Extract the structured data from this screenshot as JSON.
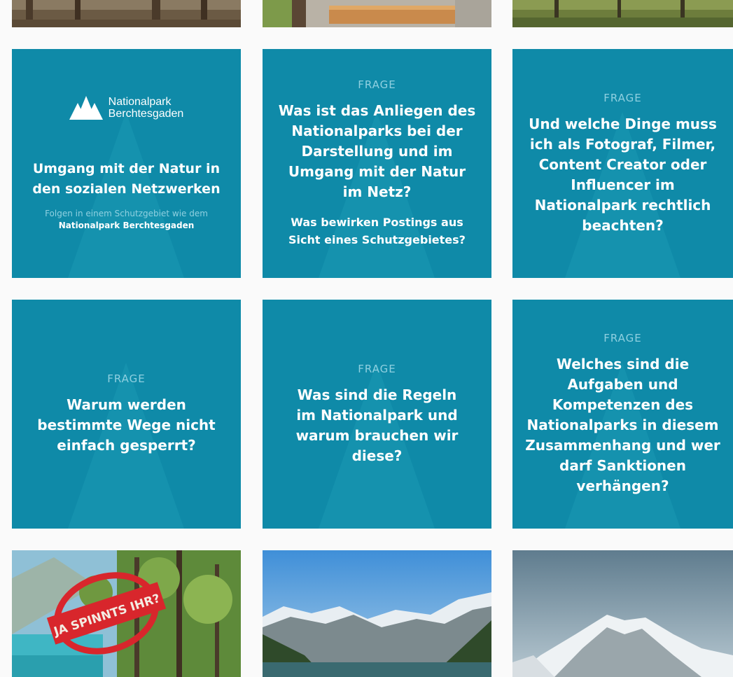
{
  "posts": {
    "intro": {
      "logo_line1": "Nationalpark",
      "logo_line2": "Berchtesgaden",
      "title": "Umgang mit der Natur in den sozialen Netzwerken",
      "tagline": "Folgen in einem Schutzgebiet wie dem",
      "tagline_strong": "Nationalpark Berchtesgaden"
    },
    "q1": {
      "label": "FRAGE",
      "question": "Was ist das Anliegen des Nationalparks bei der Darstellung und im Umgang mit der Natur im Netz?",
      "sub": "Was bewirken Postings aus Sicht eines Schutzgebietes?"
    },
    "q2": {
      "label": "FRAGE",
      "question": "Und welche Dinge muss ich als Fotograf, Filmer, Content Creator oder Influencer im Nationalpark rechtlich beachten?"
    },
    "q3": {
      "label": "FRAGE",
      "question": "Warum werden bestimmte Wege nicht einfach gesperrt?"
    },
    "q4": {
      "label": "FRAGE",
      "question": "Was sind die Regeln im Nationalpark und warum brauchen wir diese?"
    },
    "q5": {
      "label": "FRAGE",
      "question": "Welches sind die Aufgaben und Kompetenzen des Nationalparks in diesem Zusammenhang und wer darf Sanktionen verhängen?"
    },
    "stamp_text": "JA SPINNTS IHR?"
  },
  "colors": {
    "card_teal": "#0f8aa8",
    "label_light": "#8fd0e0",
    "stamp_red": "#d8262c"
  }
}
